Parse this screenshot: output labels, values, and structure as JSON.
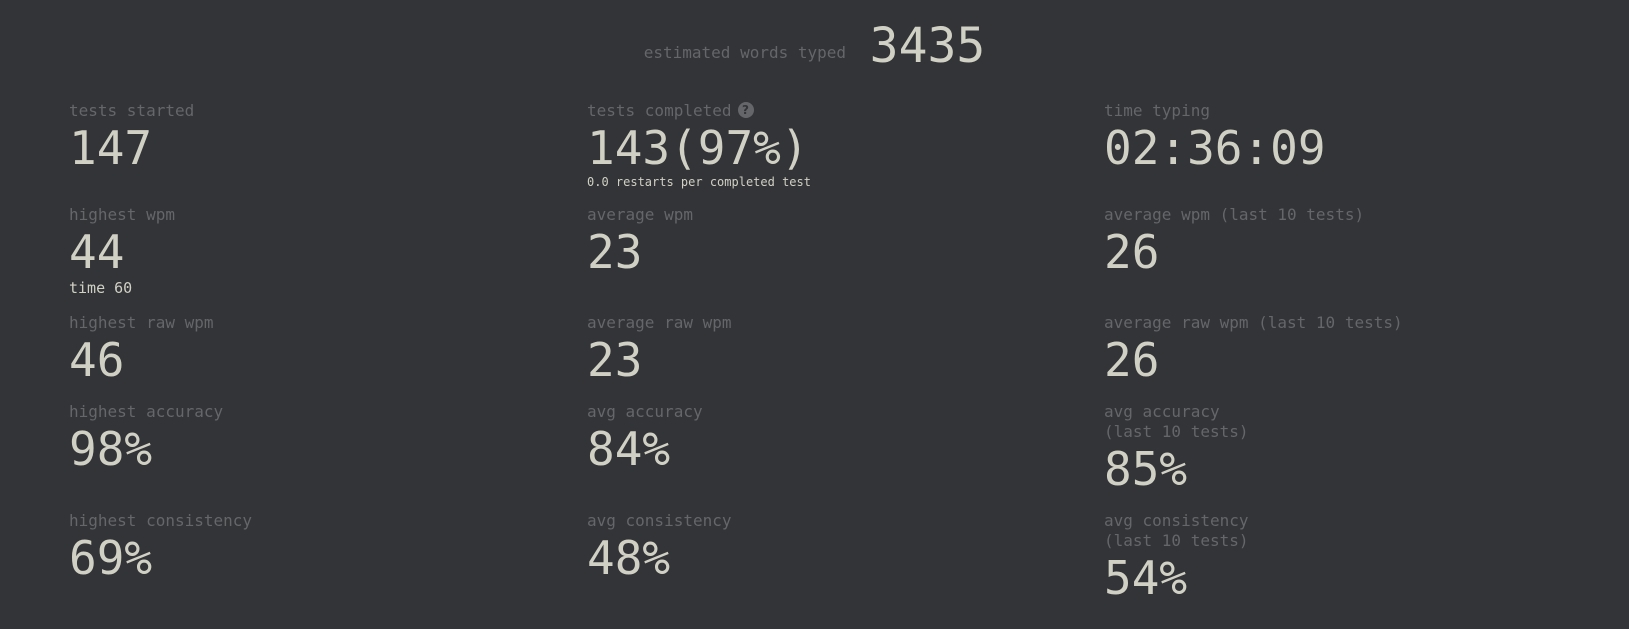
{
  "words_typed": {
    "label": "estimated words typed",
    "value": "3435"
  },
  "stats": {
    "tests_started": {
      "label": "tests started",
      "value": "147"
    },
    "tests_completed": {
      "label": "tests completed",
      "value": "143(97%)",
      "sub": "0.0 restarts per completed test",
      "icon": "help-icon",
      "icon_glyph": "?"
    },
    "time_typing": {
      "label": "time typing",
      "value": "02:36:09"
    },
    "highest_wpm": {
      "label": "highest wpm",
      "value": "44",
      "sub": "time 60"
    },
    "average_wpm": {
      "label": "average wpm",
      "value": "23"
    },
    "average_wpm_last10": {
      "label": "average wpm (last 10 tests)",
      "value": "26"
    },
    "highest_raw_wpm": {
      "label": "highest raw wpm",
      "value": "46"
    },
    "average_raw_wpm": {
      "label": "average raw wpm",
      "value": "23"
    },
    "average_raw_wpm_last10": {
      "label": "average raw wpm (last 10 tests)",
      "value": "26"
    },
    "highest_accuracy": {
      "label": "highest accuracy",
      "value": "98%"
    },
    "avg_accuracy": {
      "label": "avg accuracy",
      "value": "84%"
    },
    "avg_accuracy_last10": {
      "label_line1": "avg accuracy",
      "label_line2": "(last 10 tests)",
      "value": "85%"
    },
    "highest_consistency": {
      "label": "highest consistency",
      "value": "69%"
    },
    "avg_consistency": {
      "label": "avg consistency",
      "value": "48%"
    },
    "avg_consistency_last10": {
      "label_line1": "avg consistency",
      "label_line2": "(last 10 tests)",
      "value": "54%"
    }
  },
  "colors": {
    "background": "#323437",
    "label": "#646669",
    "value": "#d1d0c5"
  }
}
